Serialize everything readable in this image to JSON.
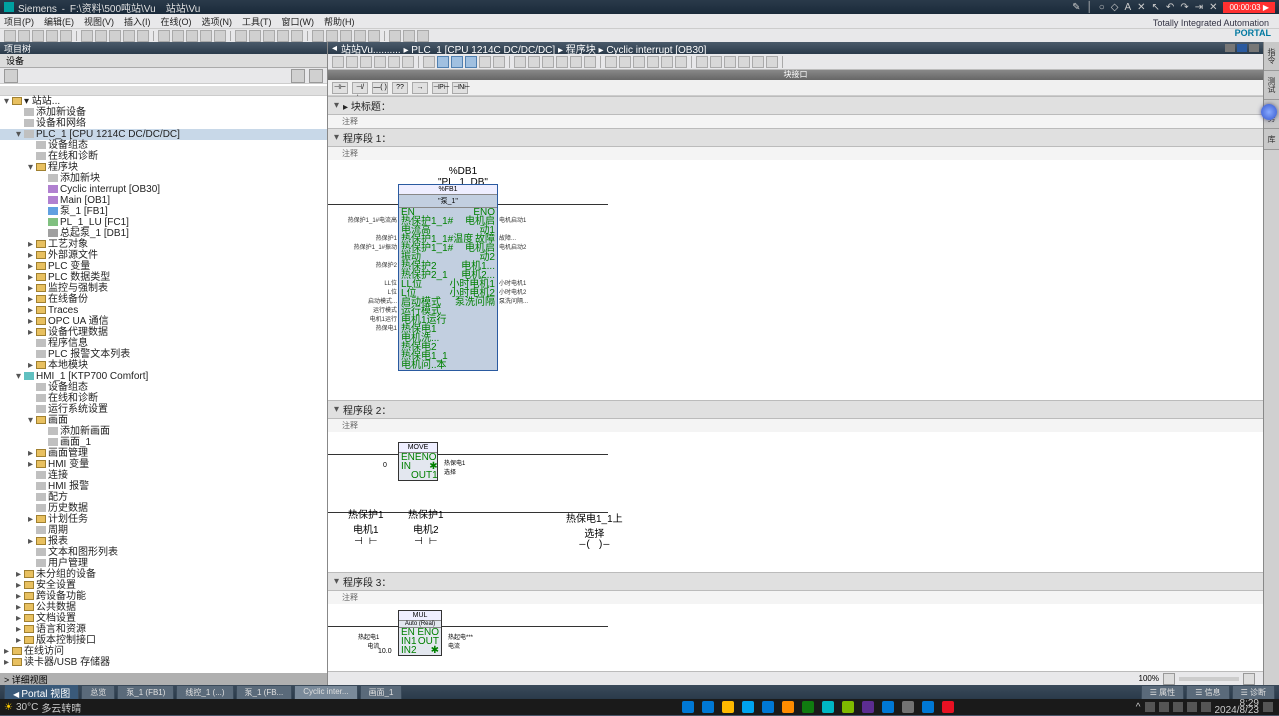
{
  "titlebar": {
    "app": "Siemens",
    "project": "F:\\资料\\500吨站\\Vu",
    "doc": "站站\\Vu",
    "rec": "00:00:03 ▶"
  },
  "topright_icons": [
    "pencil",
    "line",
    "circle",
    "eraser",
    "text",
    "crop",
    "pointer",
    "undo",
    "redo",
    "pin",
    "close"
  ],
  "branding": {
    "line1": "Totally Integrated Automation",
    "line2": "PORTAL"
  },
  "menubar": [
    "项目(P)",
    "编辑(E)",
    "视图(V)",
    "插入(I)",
    "在线(O)",
    "选项(N)",
    "工具(T)",
    "窗口(W)",
    "帮助(H)"
  ],
  "toolbar_left_count": 28,
  "left": {
    "title": "项目树",
    "tab": "设备",
    "footer": "> 详细视图",
    "tree": [
      {
        "lvl": 0,
        "tog": "▾",
        "ico": "folder",
        "txt": "▾ 站站..."
      },
      {
        "lvl": 1,
        "tog": " ",
        "ico": "dev",
        "txt": "添加新设备"
      },
      {
        "lvl": 1,
        "tog": " ",
        "ico": "dev",
        "txt": "设备和网络"
      },
      {
        "lvl": 1,
        "tog": "▾",
        "ico": "dev",
        "txt": "PLC_1 [CPU 1214C DC/DC/DC]",
        "sel": true
      },
      {
        "lvl": 2,
        "tog": " ",
        "ico": "dev",
        "txt": "设备组态"
      },
      {
        "lvl": 2,
        "tog": " ",
        "ico": "dev",
        "txt": "在线和诊断"
      },
      {
        "lvl": 2,
        "tog": "▾",
        "ico": "folder",
        "txt": "程序块"
      },
      {
        "lvl": 3,
        "tog": " ",
        "ico": "dev",
        "txt": "添加新块"
      },
      {
        "lvl": 3,
        "tog": " ",
        "ico": "block-ob",
        "txt": "Cyclic interrupt [OB30]"
      },
      {
        "lvl": 3,
        "tog": " ",
        "ico": "block-ob",
        "txt": "Main [OB1]"
      },
      {
        "lvl": 3,
        "tog": " ",
        "ico": "block-fb",
        "txt": "泵_1 [FB1]"
      },
      {
        "lvl": 3,
        "tog": " ",
        "ico": "block-fc",
        "txt": "PL_1_LU [FC1]"
      },
      {
        "lvl": 3,
        "tog": " ",
        "ico": "block-db",
        "txt": "总起泵_1 [DB1]"
      },
      {
        "lvl": 2,
        "tog": "▸",
        "ico": "folder",
        "txt": "工艺对象"
      },
      {
        "lvl": 2,
        "tog": "▸",
        "ico": "folder",
        "txt": "外部源文件"
      },
      {
        "lvl": 2,
        "tog": "▸",
        "ico": "folder",
        "txt": "PLC 变量"
      },
      {
        "lvl": 2,
        "tog": "▸",
        "ico": "folder",
        "txt": "PLC 数据类型"
      },
      {
        "lvl": 2,
        "tog": "▸",
        "ico": "folder",
        "txt": "监控与强制表"
      },
      {
        "lvl": 2,
        "tog": "▸",
        "ico": "folder",
        "txt": "在线备份"
      },
      {
        "lvl": 2,
        "tog": "▸",
        "ico": "folder",
        "txt": "Traces"
      },
      {
        "lvl": 2,
        "tog": "▸",
        "ico": "folder",
        "txt": "OPC UA 通信"
      },
      {
        "lvl": 2,
        "tog": "▸",
        "ico": "folder",
        "txt": "设备代理数据"
      },
      {
        "lvl": 2,
        "tog": " ",
        "ico": "dev",
        "txt": "程序信息"
      },
      {
        "lvl": 2,
        "tog": " ",
        "ico": "dev",
        "txt": "PLC 报警文本列表"
      },
      {
        "lvl": 2,
        "tog": "▸",
        "ico": "folder",
        "txt": "本地模块"
      },
      {
        "lvl": 1,
        "tog": "▾",
        "ico": "hmi",
        "txt": "HMI_1 [KTP700 Comfort]"
      },
      {
        "lvl": 2,
        "tog": " ",
        "ico": "dev",
        "txt": "设备组态"
      },
      {
        "lvl": 2,
        "tog": " ",
        "ico": "dev",
        "txt": "在线和诊断"
      },
      {
        "lvl": 2,
        "tog": " ",
        "ico": "dev",
        "txt": "运行系统设置"
      },
      {
        "lvl": 2,
        "tog": "▾",
        "ico": "folder",
        "txt": "画面"
      },
      {
        "lvl": 3,
        "tog": " ",
        "ico": "dev",
        "txt": "添加新画面"
      },
      {
        "lvl": 3,
        "tog": " ",
        "ico": "dev",
        "txt": "画面_1"
      },
      {
        "lvl": 2,
        "tog": "▸",
        "ico": "folder",
        "txt": "画面管理"
      },
      {
        "lvl": 2,
        "tog": "▸",
        "ico": "folder",
        "txt": "HMI 变量"
      },
      {
        "lvl": 2,
        "tog": " ",
        "ico": "dev",
        "txt": "连接"
      },
      {
        "lvl": 2,
        "tog": " ",
        "ico": "dev",
        "txt": "HMI 报警"
      },
      {
        "lvl": 2,
        "tog": " ",
        "ico": "dev",
        "txt": "配方"
      },
      {
        "lvl": 2,
        "tog": " ",
        "ico": "dev",
        "txt": "历史数据"
      },
      {
        "lvl": 2,
        "tog": "▸",
        "ico": "folder",
        "txt": "计划任务"
      },
      {
        "lvl": 2,
        "tog": " ",
        "ico": "dev",
        "txt": "周期"
      },
      {
        "lvl": 2,
        "tog": "▸",
        "ico": "folder",
        "txt": "报表"
      },
      {
        "lvl": 2,
        "tog": " ",
        "ico": "dev",
        "txt": "文本和图形列表"
      },
      {
        "lvl": 2,
        "tog": " ",
        "ico": "dev",
        "txt": "用户管理"
      },
      {
        "lvl": 1,
        "tog": "▸",
        "ico": "folder",
        "txt": "未分组的设备"
      },
      {
        "lvl": 1,
        "tog": "▸",
        "ico": "folder",
        "txt": "安全设置"
      },
      {
        "lvl": 1,
        "tog": "▸",
        "ico": "folder",
        "txt": "跨设备功能"
      },
      {
        "lvl": 1,
        "tog": "▸",
        "ico": "folder",
        "txt": "公共数据"
      },
      {
        "lvl": 1,
        "tog": "▸",
        "ico": "folder",
        "txt": "文档设置"
      },
      {
        "lvl": 1,
        "tog": "▸",
        "ico": "folder",
        "txt": "语言和资源"
      },
      {
        "lvl": 1,
        "tog": "▸",
        "ico": "folder",
        "txt": "版本控制接口"
      },
      {
        "lvl": 0,
        "tog": "▸",
        "ico": "folder",
        "txt": "在线访问"
      },
      {
        "lvl": 0,
        "tog": "▸",
        "ico": "folder",
        "txt": "读卡器/USB 存储器"
      }
    ]
  },
  "editor": {
    "path": [
      "站站Vu..........",
      "PLC_1 [CPU 1214C DC/DC/DC]",
      "程序块",
      "Cyclic interrupt [OB30]"
    ],
    "blk_iface_title": "块接口",
    "favorites": [
      "⊣⊢",
      "⊣/⊢",
      "—( )",
      "??",
      "→",
      "⊣P⊢",
      "⊣N⊢"
    ],
    "sect_title": "▸ 块标题：",
    "sect_comment": "注释",
    "nw1": {
      "title": "程序段 1：",
      "comment": "注释",
      "db": "%DB1",
      "db_name": "\"PL_1_DB\"",
      "fb": "%FB1",
      "fb_name": "\"泵_1\"",
      "en": "EN",
      "eno": "ENO",
      "pins_l": [
        "热保护1_1#电流高",
        "热保护1_1#温度",
        "热保护1_1#振动",
        "热保护2",
        "热保护2_1",
        "LL位",
        "L位",
        "启动模式",
        "运行模式",
        "电机1运行",
        "热保电1",
        "电机洗...",
        "热保电2",
        "热保电1_1",
        "电机问..本"
      ],
      "tags_l": [
        "热保护1_1#电流高",
        "热保护1",
        "热保护1_1#振动",
        "热保护2",
        "",
        "LL位",
        "L位",
        "启动模式...",
        "运行模式",
        "电机1运行",
        "热保电1",
        "",
        "",
        "",
        ""
      ],
      "pins_r": [
        "电机启动1",
        "故障",
        "电机启动2",
        "电机1...",
        "电机2...",
        "小时电机1",
        "小时电机2",
        "泵洗问隔"
      ],
      "tags_r": [
        "电机启动1",
        "故障...",
        "电机启动2",
        "",
        "",
        "小时电机1",
        "小时电机2",
        "泵洗问隔..."
      ]
    },
    "nw2": {
      "title": "程序段 2：",
      "comment": "注释",
      "move": "MOVE",
      "en": "EN",
      "eno": "ENO",
      "in": "IN",
      "out": "OUT1",
      "in_val": "0",
      "out_tag": "热保电1\n选择",
      "c1_tag": "热保护1\n电机1",
      "c2_tag": "热保护1\n电机2",
      "coil_tag": "热保电1_1上\n选择"
    },
    "nw3": {
      "title": "程序段 3：",
      "comment": "注释",
      "blk": "MUL",
      "blk_sub": "Auto (Real)",
      "en": "EN",
      "eno": "ENO",
      "in1": "IN1",
      "in2": "IN2",
      "out": "OUT",
      "in1_tag": "热起电1\n电流",
      "in2_val": "10.0",
      "out_tag": "热起电***\n电流"
    },
    "zoom": "100%"
  },
  "right_tabs": [
    "指令",
    "测试",
    "任务",
    "库"
  ],
  "bottom": {
    "portal": "Portal 视图",
    "tabs": [
      "总览",
      "泵_1 (FB1)",
      "线控_1 (...)",
      "泵_1 (FB...",
      "Cyclic inter...",
      "画面_1"
    ],
    "active": 4,
    "status": [
      "属性",
      "信息",
      "诊断"
    ]
  },
  "taskbar": {
    "weather_temp": "30°C",
    "weather_desc": "多云转晴",
    "time": "8:29",
    "date": "2024/8/23"
  }
}
